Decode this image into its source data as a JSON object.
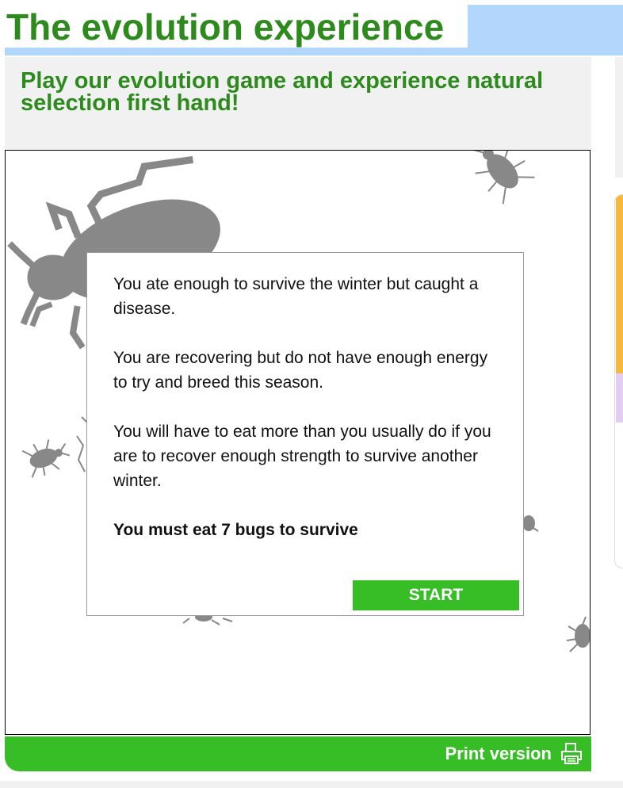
{
  "header": {
    "title": "The evolution experience",
    "subtitle": "Play our evolution game and experience natural selection first hand!"
  },
  "dialog": {
    "paragraphs": [
      "You ate enough to survive the winter but caught a disease.",
      "You are recovering but do not have enough energy to try and breed this season.",
      "You will have to eat more than you usually do if you are to recover enough strength to survive another winter."
    ],
    "goal": "You must eat 7 bugs to survive",
    "start_label": "START"
  },
  "footer": {
    "print_label": "Print version",
    "print_icon": "printer-icon"
  },
  "colors": {
    "title_green": "#2d8a1d",
    "button_green": "#37bd25",
    "title_band_blue": "#b2d6fc",
    "panel_grey": "#f1f1f1",
    "bug_grey": "#888888"
  }
}
